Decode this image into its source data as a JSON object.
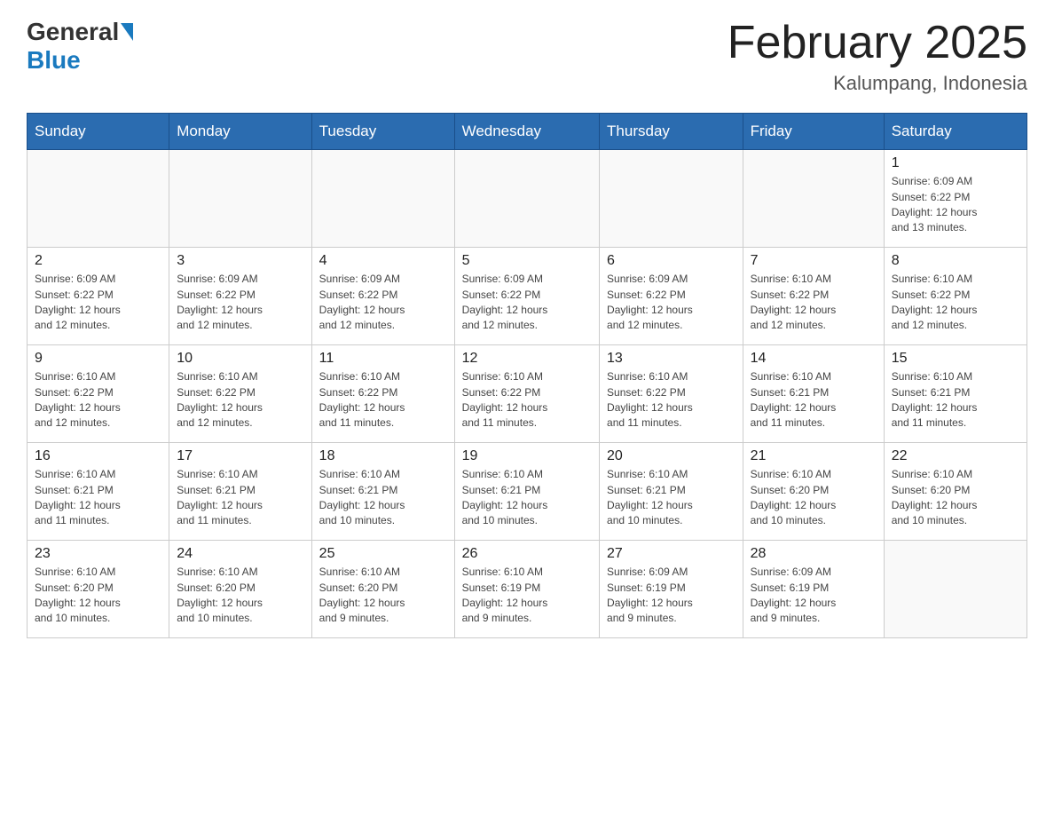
{
  "header": {
    "logo": {
      "general": "General",
      "blue": "Blue"
    },
    "title": "February 2025",
    "location": "Kalumpang, Indonesia"
  },
  "days_of_week": [
    "Sunday",
    "Monday",
    "Tuesday",
    "Wednesday",
    "Thursday",
    "Friday",
    "Saturday"
  ],
  "weeks": [
    {
      "days": [
        {
          "num": "",
          "info": ""
        },
        {
          "num": "",
          "info": ""
        },
        {
          "num": "",
          "info": ""
        },
        {
          "num": "",
          "info": ""
        },
        {
          "num": "",
          "info": ""
        },
        {
          "num": "",
          "info": ""
        },
        {
          "num": "1",
          "info": "Sunrise: 6:09 AM\nSunset: 6:22 PM\nDaylight: 12 hours\nand 13 minutes."
        }
      ]
    },
    {
      "days": [
        {
          "num": "2",
          "info": "Sunrise: 6:09 AM\nSunset: 6:22 PM\nDaylight: 12 hours\nand 12 minutes."
        },
        {
          "num": "3",
          "info": "Sunrise: 6:09 AM\nSunset: 6:22 PM\nDaylight: 12 hours\nand 12 minutes."
        },
        {
          "num": "4",
          "info": "Sunrise: 6:09 AM\nSunset: 6:22 PM\nDaylight: 12 hours\nand 12 minutes."
        },
        {
          "num": "5",
          "info": "Sunrise: 6:09 AM\nSunset: 6:22 PM\nDaylight: 12 hours\nand 12 minutes."
        },
        {
          "num": "6",
          "info": "Sunrise: 6:09 AM\nSunset: 6:22 PM\nDaylight: 12 hours\nand 12 minutes."
        },
        {
          "num": "7",
          "info": "Sunrise: 6:10 AM\nSunset: 6:22 PM\nDaylight: 12 hours\nand 12 minutes."
        },
        {
          "num": "8",
          "info": "Sunrise: 6:10 AM\nSunset: 6:22 PM\nDaylight: 12 hours\nand 12 minutes."
        }
      ]
    },
    {
      "days": [
        {
          "num": "9",
          "info": "Sunrise: 6:10 AM\nSunset: 6:22 PM\nDaylight: 12 hours\nand 12 minutes."
        },
        {
          "num": "10",
          "info": "Sunrise: 6:10 AM\nSunset: 6:22 PM\nDaylight: 12 hours\nand 12 minutes."
        },
        {
          "num": "11",
          "info": "Sunrise: 6:10 AM\nSunset: 6:22 PM\nDaylight: 12 hours\nand 11 minutes."
        },
        {
          "num": "12",
          "info": "Sunrise: 6:10 AM\nSunset: 6:22 PM\nDaylight: 12 hours\nand 11 minutes."
        },
        {
          "num": "13",
          "info": "Sunrise: 6:10 AM\nSunset: 6:22 PM\nDaylight: 12 hours\nand 11 minutes."
        },
        {
          "num": "14",
          "info": "Sunrise: 6:10 AM\nSunset: 6:21 PM\nDaylight: 12 hours\nand 11 minutes."
        },
        {
          "num": "15",
          "info": "Sunrise: 6:10 AM\nSunset: 6:21 PM\nDaylight: 12 hours\nand 11 minutes."
        }
      ]
    },
    {
      "days": [
        {
          "num": "16",
          "info": "Sunrise: 6:10 AM\nSunset: 6:21 PM\nDaylight: 12 hours\nand 11 minutes."
        },
        {
          "num": "17",
          "info": "Sunrise: 6:10 AM\nSunset: 6:21 PM\nDaylight: 12 hours\nand 11 minutes."
        },
        {
          "num": "18",
          "info": "Sunrise: 6:10 AM\nSunset: 6:21 PM\nDaylight: 12 hours\nand 10 minutes."
        },
        {
          "num": "19",
          "info": "Sunrise: 6:10 AM\nSunset: 6:21 PM\nDaylight: 12 hours\nand 10 minutes."
        },
        {
          "num": "20",
          "info": "Sunrise: 6:10 AM\nSunset: 6:21 PM\nDaylight: 12 hours\nand 10 minutes."
        },
        {
          "num": "21",
          "info": "Sunrise: 6:10 AM\nSunset: 6:20 PM\nDaylight: 12 hours\nand 10 minutes."
        },
        {
          "num": "22",
          "info": "Sunrise: 6:10 AM\nSunset: 6:20 PM\nDaylight: 12 hours\nand 10 minutes."
        }
      ]
    },
    {
      "days": [
        {
          "num": "23",
          "info": "Sunrise: 6:10 AM\nSunset: 6:20 PM\nDaylight: 12 hours\nand 10 minutes."
        },
        {
          "num": "24",
          "info": "Sunrise: 6:10 AM\nSunset: 6:20 PM\nDaylight: 12 hours\nand 10 minutes."
        },
        {
          "num": "25",
          "info": "Sunrise: 6:10 AM\nSunset: 6:20 PM\nDaylight: 12 hours\nand 9 minutes."
        },
        {
          "num": "26",
          "info": "Sunrise: 6:10 AM\nSunset: 6:19 PM\nDaylight: 12 hours\nand 9 minutes."
        },
        {
          "num": "27",
          "info": "Sunrise: 6:09 AM\nSunset: 6:19 PM\nDaylight: 12 hours\nand 9 minutes."
        },
        {
          "num": "28",
          "info": "Sunrise: 6:09 AM\nSunset: 6:19 PM\nDaylight: 12 hours\nand 9 minutes."
        },
        {
          "num": "",
          "info": ""
        }
      ]
    }
  ]
}
